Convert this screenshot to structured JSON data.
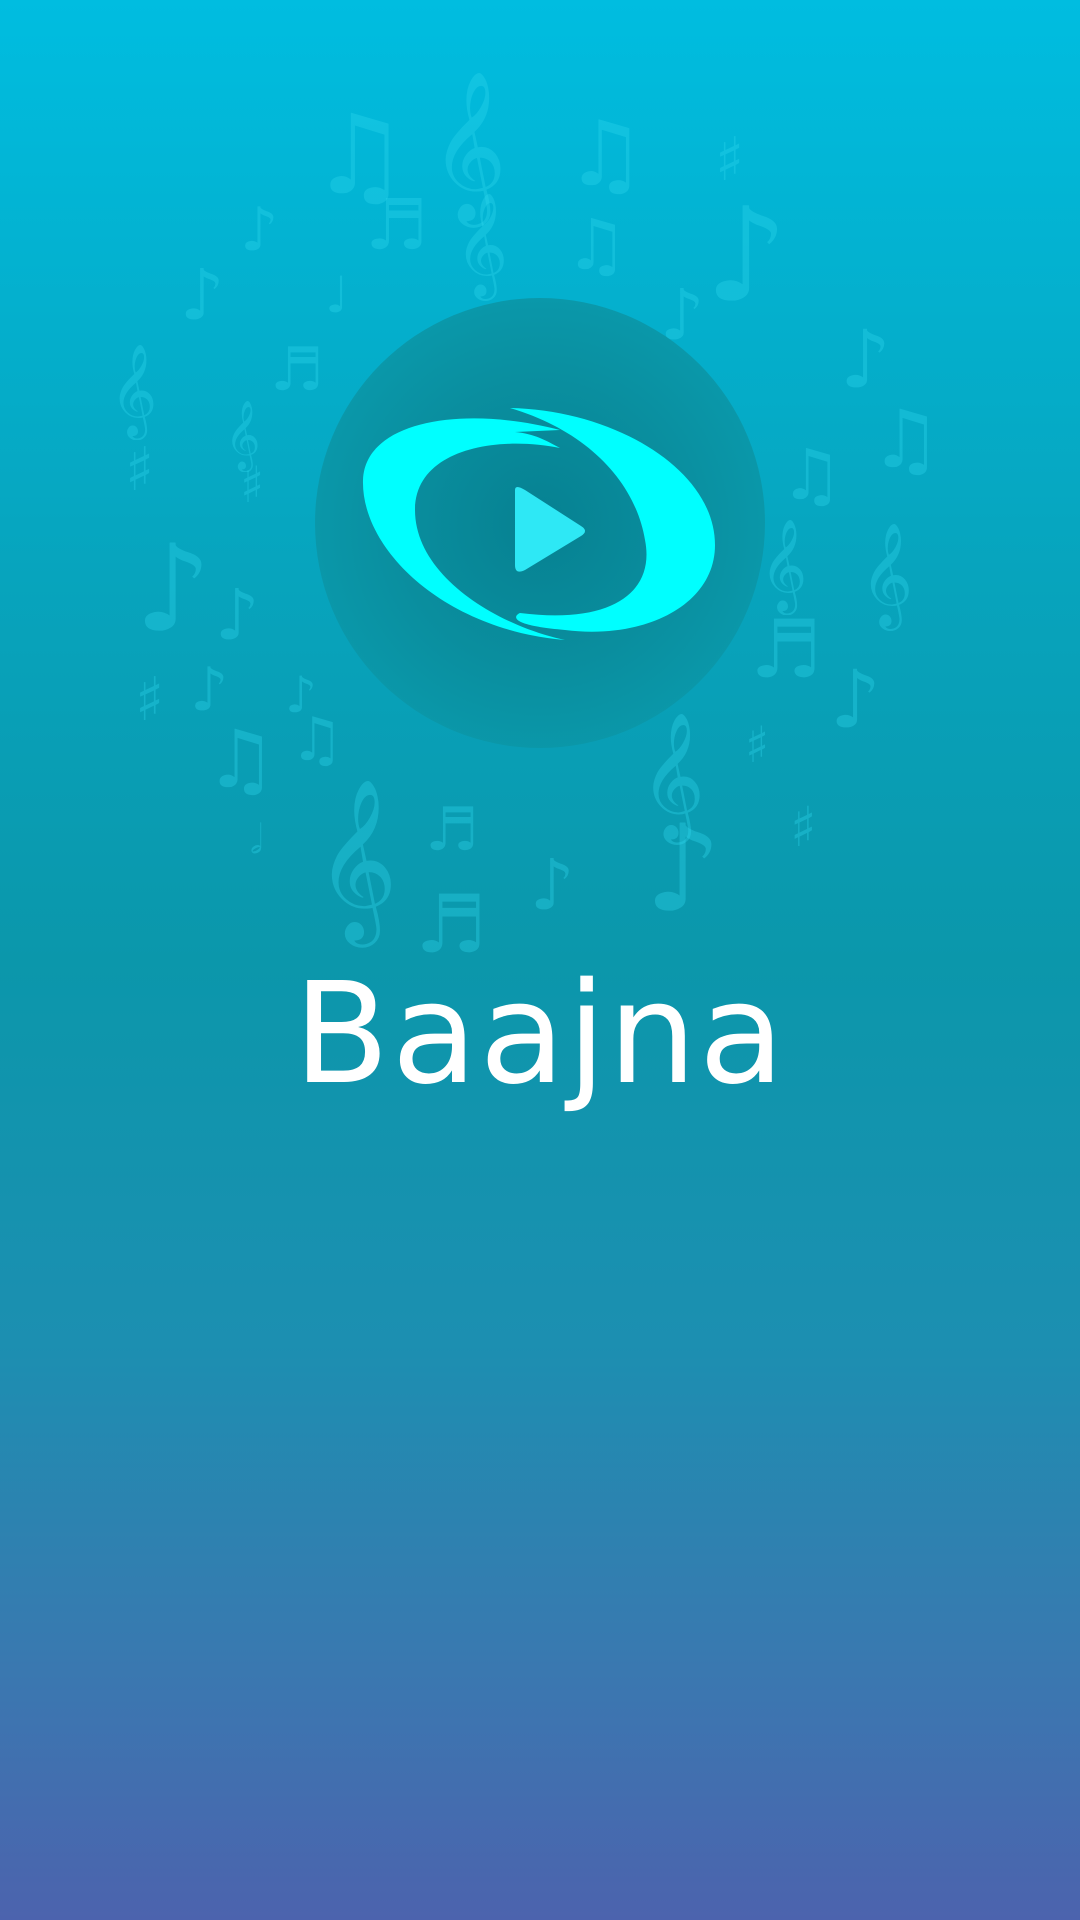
{
  "app": {
    "title": "Baajna"
  },
  "logo": {
    "icon": "play-icon",
    "accent_color": "#00ffff"
  },
  "background": {
    "top_color": "#00bde0",
    "bottom_color": "#4c63ae"
  },
  "decoration": {
    "icon": "music-notes-icon"
  }
}
